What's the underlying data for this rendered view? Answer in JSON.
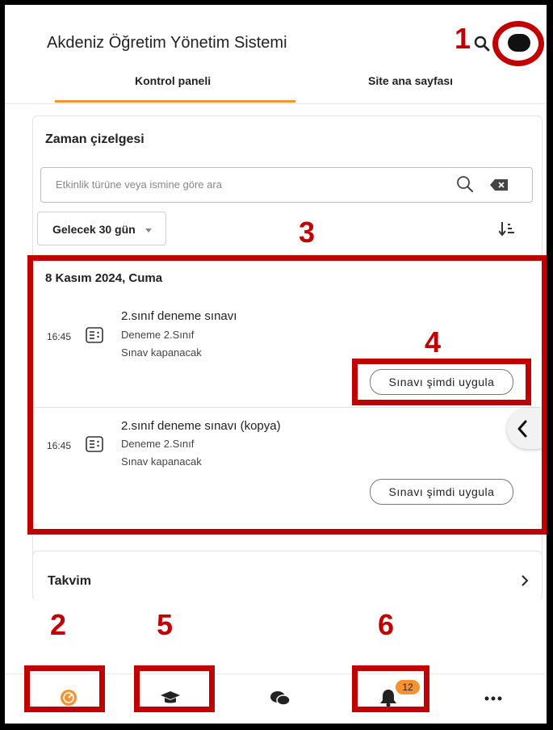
{
  "header": {
    "app_title": "Akdeniz Öğretim Yönetim Sistemi",
    "tabs": [
      {
        "label": "Kontrol paneli",
        "active": true
      },
      {
        "label": "Site ana sayfası",
        "active": false
      }
    ]
  },
  "timeline": {
    "title": "Zaman çizelgesi",
    "search_placeholder": "Etkinlik türüne veya ismine göre ara",
    "filter_selected": "Gelecek 30 gün",
    "date_heading": "8 Kasım 2024, Cuma",
    "events": [
      {
        "time": "16:45",
        "title": "2.sınıf deneme sınavı",
        "course": "Deneme 2.Sınıf",
        "status": "Sınav kapanacak",
        "action": "Sınavı şimdi uygula"
      },
      {
        "time": "16:45",
        "title": "2.sınıf deneme sınavı (kopya)",
        "course": "Deneme 2.Sınıf",
        "status": "Sınav kapanacak",
        "action": "Sınavı şimdi uygula"
      }
    ]
  },
  "calendar": {
    "label": "Takvim"
  },
  "bottom_nav": {
    "items": [
      "dashboard-icon",
      "courses-icon",
      "messages-icon",
      "notifications-icon",
      "more-icon"
    ],
    "notification_count": "12"
  },
  "annotations": {
    "callouts": [
      "1",
      "2",
      "3",
      "4",
      "5",
      "6"
    ],
    "color": "#c00000"
  },
  "colors": {
    "accent": "#f39433",
    "annotation": "#c00000"
  }
}
